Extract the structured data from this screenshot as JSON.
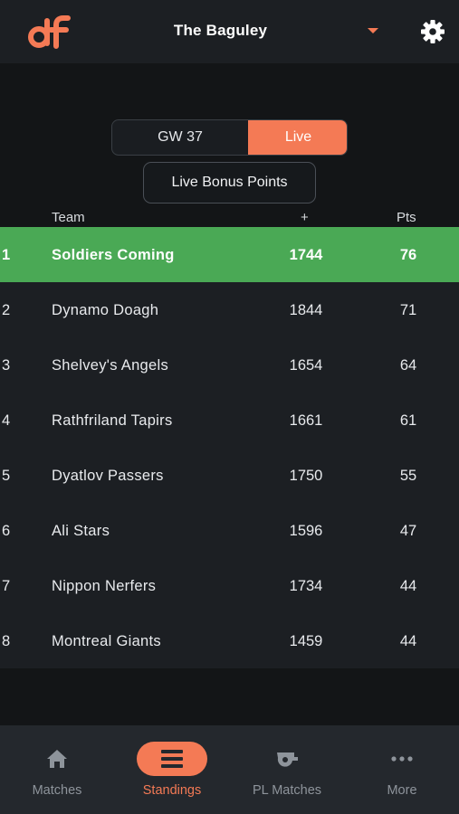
{
  "header": {
    "league_name": "The Baguley",
    "logo_icon": "df-logo-icon",
    "settings_icon": "gear-icon"
  },
  "toggle": {
    "gameweek_label": "GW 37",
    "live_label": "Live",
    "selected": "Live"
  },
  "bonus_button_label": "Live Bonus Points",
  "columns": {
    "team": "Team",
    "plus": "+",
    "pts": "Pts"
  },
  "standings": [
    {
      "rank": "1",
      "team": "Soldiers Coming",
      "plus": "1744",
      "pts": "76"
    },
    {
      "rank": "2",
      "team": "Dynamo Doagh",
      "plus": "1844",
      "pts": "71"
    },
    {
      "rank": "3",
      "team": "Shelvey's Angels",
      "plus": "1654",
      "pts": "64"
    },
    {
      "rank": "4",
      "team": "Rathfriland Tapirs",
      "plus": "1661",
      "pts": "61"
    },
    {
      "rank": "5",
      "team": "Dyatlov Passers",
      "plus": "1750",
      "pts": "55"
    },
    {
      "rank": "6",
      "team": "Ali Stars",
      "plus": "1596",
      "pts": "47"
    },
    {
      "rank": "7",
      "team": "Nippon Nerfers",
      "plus": "1734",
      "pts": "44"
    },
    {
      "rank": "8",
      "team": "Montreal Giants",
      "plus": "1459",
      "pts": "44"
    }
  ],
  "nav": [
    {
      "label": "Matches",
      "icon": "home-icon",
      "active": false
    },
    {
      "label": "Standings",
      "icon": "list-icon",
      "active": true
    },
    {
      "label": "PL Matches",
      "icon": "whistle-icon",
      "active": false
    },
    {
      "label": "More",
      "icon": "more-dots-icon",
      "active": false
    }
  ],
  "colors": {
    "accent": "#f47a55",
    "leader_row": "#4aa955",
    "background": "#131517",
    "surface": "#1c1f23"
  }
}
